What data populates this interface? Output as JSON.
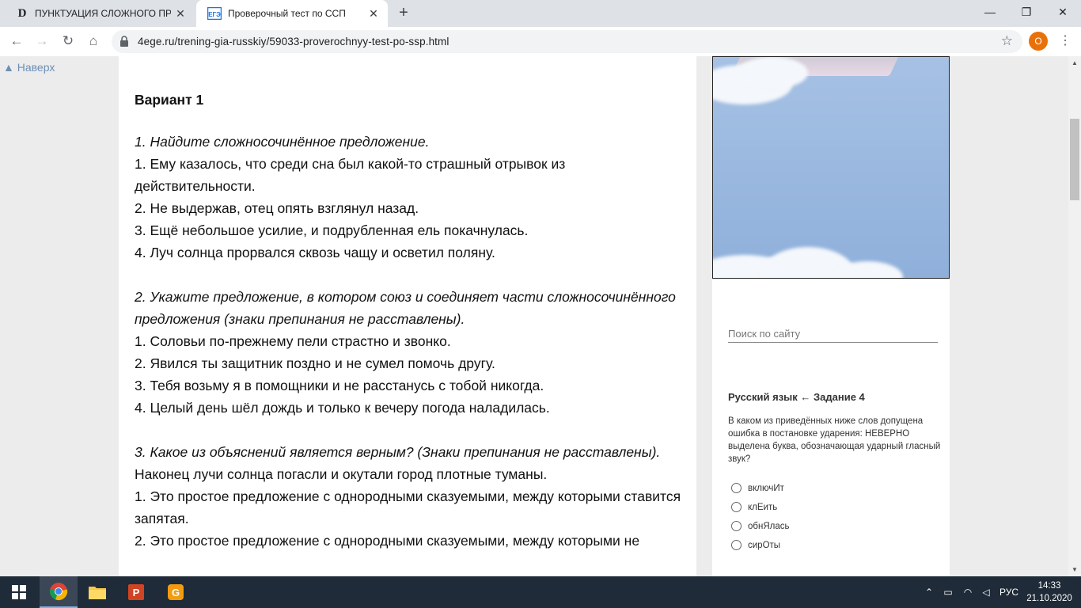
{
  "browser": {
    "tabs": [
      {
        "title": "ПУНКТУАЦИЯ СЛОЖНОГО ПРЕДЛОЖЕНИЯ",
        "favicon": "D",
        "active": false
      },
      {
        "title": "Проверочный тест по ССП",
        "favicon": "ЕГЭ",
        "active": true
      }
    ],
    "new_tab": "+",
    "url": "4ege.ru/trening-gia-russkiy/59033-proverochnyy-test-po-ssp.html",
    "profile_initial": "O",
    "window_controls": {
      "minimize": "—",
      "restore": "❐",
      "close": "✕"
    }
  },
  "page": {
    "back_to_top": "▲ Наверх",
    "variant_title": "Вариант 1",
    "questions": [
      {
        "prompt": "1. Найдите сложносочинённое предложение.",
        "lines": [
          "1. Ему казалось, что среди сна был какой-то страшный отрывок из действительности.",
          "2. Не выдержав, отец опять взглянул назад.",
          "3. Ещё небольшое усилие, и подрубленная ель покачнулась.",
          "4. Луч солнца прорвался сквозь чащу и осветил поляну."
        ]
      },
      {
        "prompt": "2. Укажите предложение, в котором союз и соединяет части сложносочинённого предложения (знаки препинания не расставлены).",
        "lines": [
          "1. Соловьи по-прежнему пели страстно и звонко.",
          "2. Явился ты защитник поздно и не сумел помочь другу.",
          "3. Тебя возьму я в помощники и не расстанусь с тобой никогда.",
          "4. Целый день шёл дождь и только к вечеру погода наладилась."
        ]
      },
      {
        "prompt": "3. Какое из объяснений является верным? (Знаки препинания не расставлены).",
        "lines": [
          "Наконец лучи солнца погасли и окутали город плотные туманы.",
          "1. Это простое предложение с однородными сказуемыми, между которыми ставится запятая.",
          "2. Это простое предложение с однородными сказуемыми, между которыми не"
        ]
      }
    ],
    "sidebar": {
      "search_placeholder": "Поиск по сайту",
      "widget_title": "Русский язык ← Задание 4",
      "widget_text": "В каком из приведённых ниже слов допущена ошибка в постановке ударения: НЕВЕРНО выделена буква, обозначающая ударный гласный звук?",
      "options": [
        "включИт",
        "клЕить",
        "обнЯлась",
        "сирОты"
      ]
    }
  },
  "taskbar": {
    "language": "РУС",
    "time": "14:33",
    "date": "21.10.2020"
  }
}
